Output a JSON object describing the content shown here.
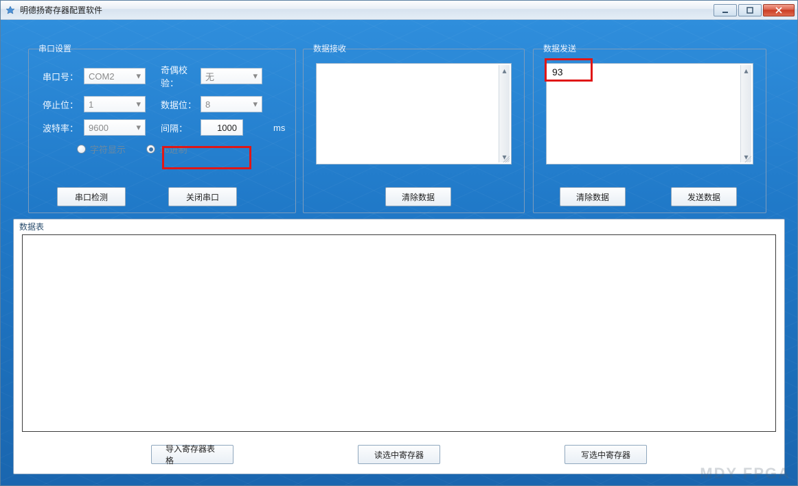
{
  "window": {
    "title": "明德扬寄存器配置软件"
  },
  "groups": {
    "serial": "串口设置",
    "recv": "数据接收",
    "send": "数据发送",
    "table": "数据表"
  },
  "serial": {
    "labels": {
      "port": "串口号：",
      "parity": "奇偶校验：",
      "stop": "停止位：",
      "databits": "数据位：",
      "baud": "波特率：",
      "interval": "间隔：",
      "unit_ms": "ms"
    },
    "values": {
      "port": "COM2",
      "parity": "无",
      "stop": "1",
      "databits": "8",
      "baud": "9600",
      "interval": "1000"
    },
    "radios": {
      "ascii": "字符显示",
      "hex": "16进制"
    }
  },
  "buttons": {
    "detect": "串口检测",
    "close_port": "关闭串口",
    "recv_clear": "清除数据",
    "send_clear": "清除数据",
    "send_send": "发送数据",
    "import_table": "导入寄存器表格",
    "read_sel": "读选中寄存器",
    "write_sel": "写选中寄存器"
  },
  "send": {
    "content": "93"
  },
  "watermark": "MDY FPGA",
  "win_controls": {
    "min": "minimize",
    "max": "maximize",
    "close": "close"
  }
}
